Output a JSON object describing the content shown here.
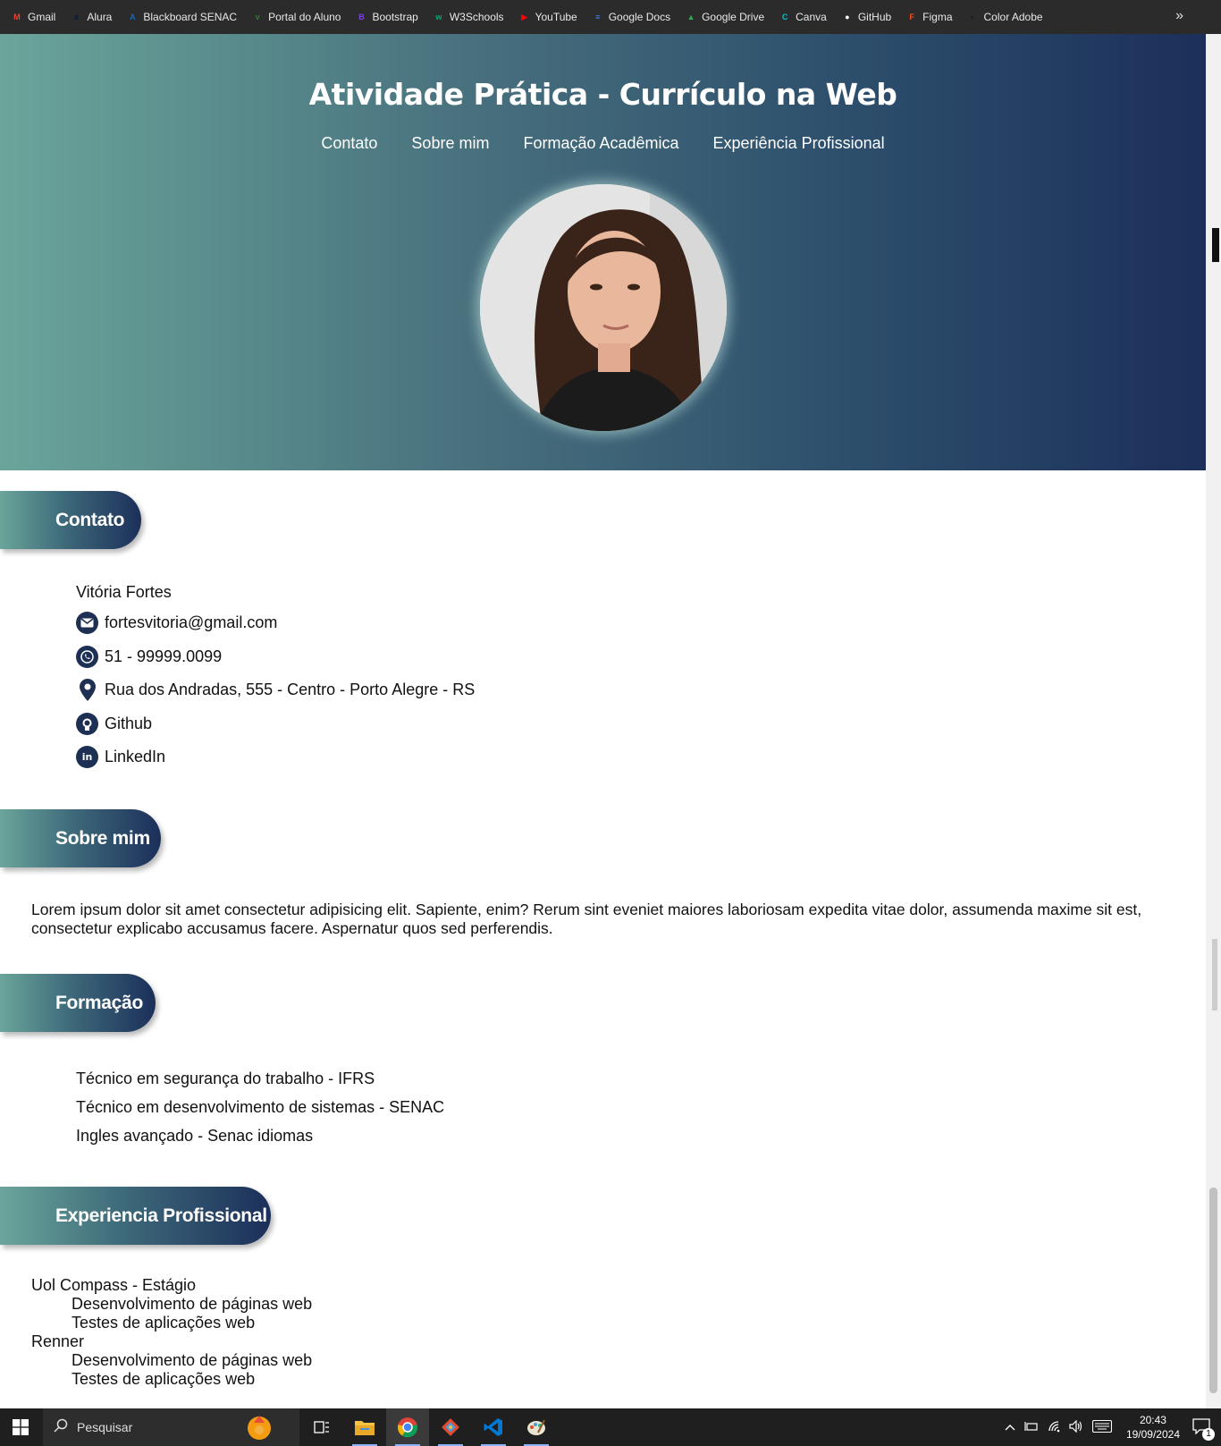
{
  "bookmarks": [
    {
      "label": "Gmail",
      "icon": "gmail-icon",
      "color": "#ea4335",
      "glyph": "M"
    },
    {
      "label": "Alura",
      "icon": "alura-icon",
      "color": "#0a1a3a",
      "glyph": "a"
    },
    {
      "label": "Blackboard SENAC",
      "icon": "blackboard-icon",
      "color": "#1565c0",
      "glyph": "A"
    },
    {
      "label": "Portal do Aluno",
      "icon": "portal-icon",
      "color": "#2e7d32",
      "glyph": "v"
    },
    {
      "label": "Bootstrap",
      "icon": "bootstrap-icon",
      "color": "#7b3fe4",
      "glyph": "B"
    },
    {
      "label": "W3Schools",
      "icon": "w3schools-icon",
      "color": "#04aa6d",
      "glyph": "w"
    },
    {
      "label": "YouTube",
      "icon": "youtube-icon",
      "color": "#ff0000",
      "glyph": "▶"
    },
    {
      "label": "Google Docs",
      "icon": "google-docs-icon",
      "color": "#4285f4",
      "glyph": "≡"
    },
    {
      "label": "Google Drive",
      "icon": "google-drive-icon",
      "color": "#34a853",
      "glyph": "▲"
    },
    {
      "label": "Canva",
      "icon": "canva-icon",
      "color": "#00c4cc",
      "glyph": "C"
    },
    {
      "label": "GitHub",
      "icon": "github-icon",
      "color": "#ffffff",
      "glyph": "●"
    },
    {
      "label": "Figma",
      "icon": "figma-icon",
      "color": "#f24e1e",
      "glyph": "F"
    },
    {
      "label": "Color Adobe",
      "icon": "adobe-color-icon",
      "color": "#1a1a1a",
      "glyph": "◐"
    }
  ],
  "header": {
    "title": "Atividade Prática - Currículo na Web",
    "nav": [
      "Contato",
      "Sobre mim",
      "Formação Acadêmica",
      "Experiência Profissional"
    ]
  },
  "sections": {
    "contato": "Contato",
    "sobre": "Sobre mim",
    "formacao": "Formação",
    "experiencia": "Experiencia Profissional"
  },
  "contact": {
    "name": "Vitória Fortes",
    "email": "fortesvitoria@gmail.com",
    "phone": "51 - 99999.0099",
    "address": "Rua dos Andradas, 555 - Centro - Porto Alegre - RS",
    "github": "Github",
    "linkedin": "LinkedIn"
  },
  "about": "Lorem ipsum dolor sit amet consectetur adipisicing elit. Sapiente, enim? Rerum sint eveniet maiores laboriosam expedita vitae dolor, assumenda maxime sit est, consectetur explicabo accusamus facere. Aspernatur quos sed perferendis.",
  "formacao": [
    "Técnico em segurança do trabalho - IFRS",
    "Técnico em desenvolvimento de sistemas - SENAC",
    "Ingles avançado - Senac idiomas"
  ],
  "experiencia": [
    {
      "company": "Uol Compass - Estágio",
      "items": [
        "Desenvolvimento de páginas web",
        "Testes de aplicações web"
      ]
    },
    {
      "company": "Renner",
      "items": [
        "Desenvolvimento de páginas web",
        "Testes de aplicações web"
      ]
    }
  ],
  "taskbar": {
    "search_placeholder": "Pesquisar",
    "time": "20:43",
    "date": "19/09/2024",
    "notifications": "1"
  },
  "colors": {
    "gradient_start": "#6aa59a",
    "gradient_end": "#1c2f5a",
    "icon_navy": "#1d2f52"
  }
}
